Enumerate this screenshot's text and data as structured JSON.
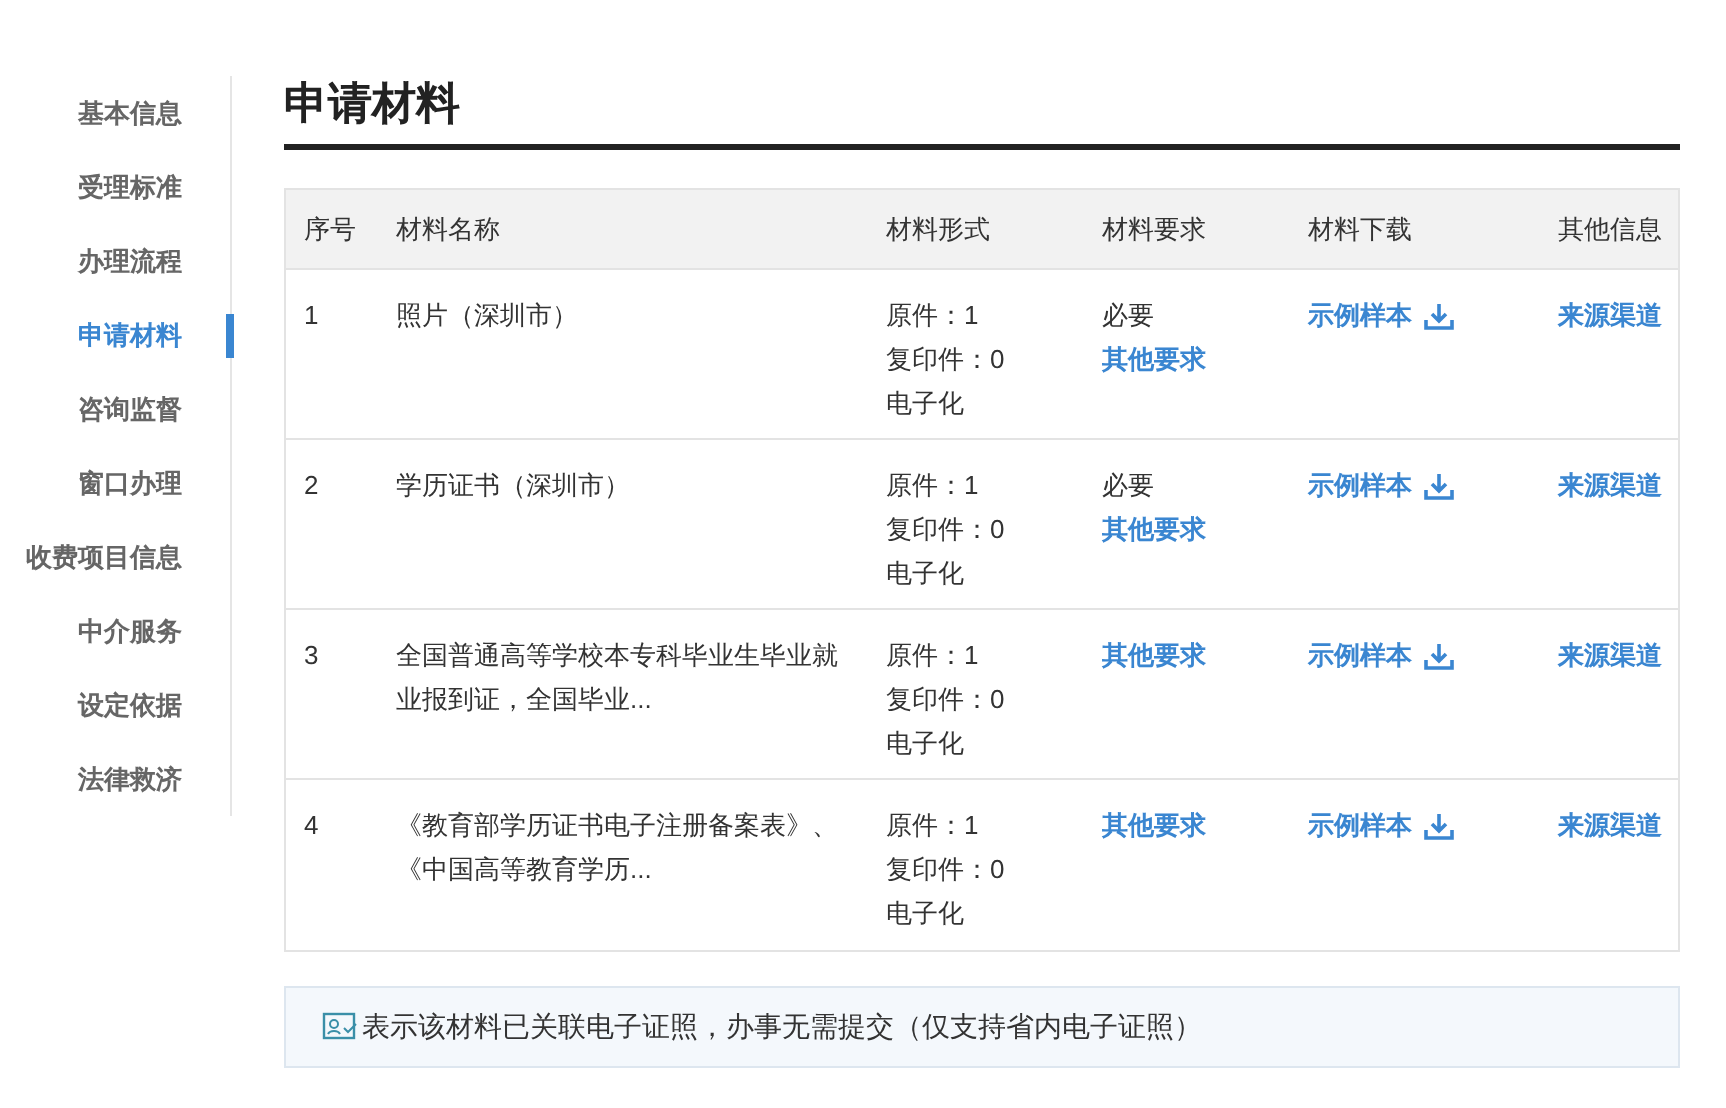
{
  "sidebar": {
    "items": [
      {
        "label": "基本信息",
        "selected": false
      },
      {
        "label": "受理标准",
        "selected": false
      },
      {
        "label": "办理流程",
        "selected": false
      },
      {
        "label": "申请材料",
        "selected": true
      },
      {
        "label": "咨询监督",
        "selected": false
      },
      {
        "label": "窗口办理",
        "selected": false
      },
      {
        "label": "收费项目信息",
        "selected": false
      },
      {
        "label": "中介服务",
        "selected": false
      },
      {
        "label": "设定依据",
        "selected": false
      },
      {
        "label": "法律救济",
        "selected": false
      }
    ]
  },
  "heading": "申请材料",
  "table": {
    "columns": [
      "序号",
      "材料名称",
      "材料形式",
      "材料要求",
      "材料下载",
      "其他信息"
    ],
    "rows": [
      {
        "index": "1",
        "name": "照片（深圳市）",
        "form": [
          "原件：1",
          "复印件：0",
          "电子化"
        ],
        "requirement": "必要",
        "requirement_link": "其他要求",
        "download": "示例样本",
        "other": "来源渠道"
      },
      {
        "index": "2",
        "name": "学历证书（深圳市）",
        "form": [
          "原件：1",
          "复印件：0",
          "电子化"
        ],
        "requirement": "必要",
        "requirement_link": "其他要求",
        "download": "示例样本",
        "other": "来源渠道"
      },
      {
        "index": "3",
        "name": "全国普通高等学校本专科毕业生毕业就业报到证，全国毕业...",
        "form": [
          "原件：1",
          "复印件：0",
          "电子化"
        ],
        "requirement_link": "其他要求",
        "download": "示例样本",
        "other": "来源渠道"
      },
      {
        "index": "4",
        "name": "《教育部学历证书电子注册备案表》、《中国高等教育学历...",
        "form": [
          "原件：1",
          "复印件：0",
          "电子化"
        ],
        "requirement_link": "其他要求",
        "download": "示例样本",
        "other": "来源渠道"
      }
    ]
  },
  "note": "表示该材料已关联电子证照，办事无需提交（仅支持省内电子证照）"
}
